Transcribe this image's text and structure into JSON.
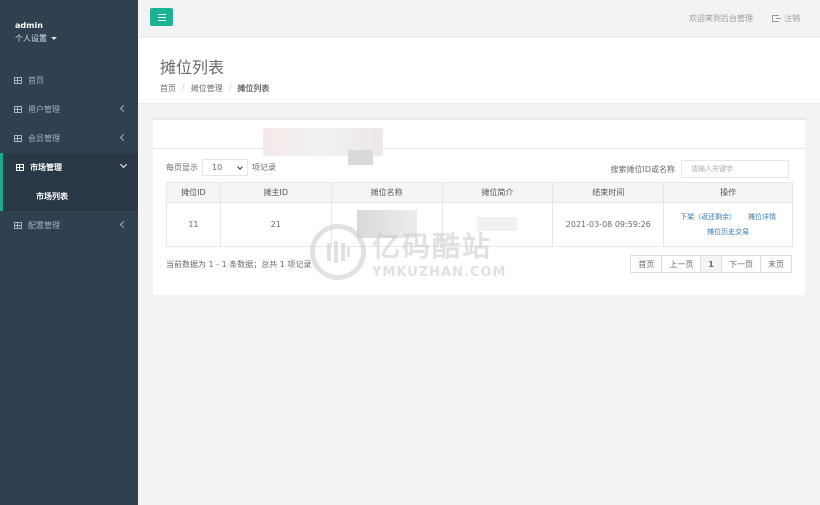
{
  "sidebar": {
    "username": "admin",
    "settings_label": "个人设置",
    "items": [
      {
        "label": "首页"
      },
      {
        "label": "用户管理"
      },
      {
        "label": "会员管理"
      },
      {
        "label": "市场管理"
      },
      {
        "label": "配置管理"
      }
    ],
    "submenu": {
      "label": "市场列表"
    }
  },
  "topbar": {
    "welcome": "欢迎来到后台管理",
    "logout": "注销"
  },
  "page": {
    "title": "摊位列表",
    "breadcrumb": [
      "首页",
      "摊位管理",
      "摊位列表"
    ]
  },
  "table_controls": {
    "per_page_prefix": "每页显示",
    "per_page_value": "10",
    "per_page_suffix": "项记录",
    "search_label": "搜索摊位ID或名称",
    "search_placeholder": "请输入关键字"
  },
  "table": {
    "headers": [
      "摊位ID",
      "摊主ID",
      "摊位名称",
      "摊位简介",
      "结束时间",
      "操作"
    ],
    "rows": [
      {
        "id": "11",
        "owner_id": "21",
        "end_time": "2021-03-08 09:59:26",
        "actions": {
          "unlist": "下架（返还剩余）",
          "detail": "摊位详情",
          "history": "摊位历史交易"
        }
      }
    ]
  },
  "footer": {
    "info": "当前数据为 1 - 1 条数据；总共 1 项记录"
  },
  "pagination": {
    "first": "首页",
    "prev": "上一页",
    "current": "1",
    "next": "下一页",
    "last": "末页"
  },
  "watermark": {
    "cn": "亿码酷站",
    "en": "YMKUZHAN.COM"
  },
  "colors": {
    "sidebar_bg": "#2f4050",
    "accent": "#1ab394",
    "link": "#337ab7"
  }
}
